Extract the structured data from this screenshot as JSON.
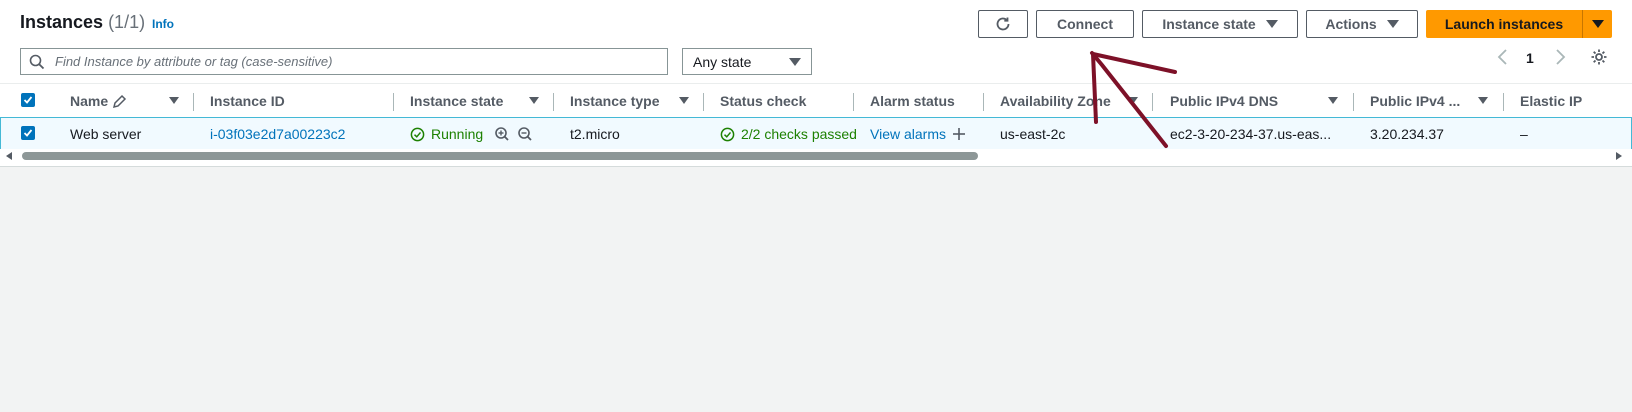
{
  "header": {
    "title": "Instances",
    "count": "(1/1)",
    "info": "Info"
  },
  "toolbar": {
    "refresh_icon": "refresh-icon",
    "connect": "Connect",
    "instance_state": "Instance state",
    "actions": "Actions",
    "launch": "Launch instances"
  },
  "filter": {
    "search_placeholder": "Find Instance by attribute or tag (case-sensitive)",
    "state_select": "Any state"
  },
  "pagination": {
    "current_page": "1"
  },
  "table": {
    "columns": [
      "Name",
      "Instance ID",
      "Instance state",
      "Instance type",
      "Status check",
      "Alarm status",
      "Availability Zone",
      "Public IPv4 DNS",
      "Public IPv4 ...",
      "Elastic IP"
    ],
    "rows": [
      {
        "name": "Web server",
        "instance_id": "i-03f03e2d7a00223c2",
        "state": "Running",
        "type": "t2.micro",
        "status_check": "2/2 checks passed",
        "alarm": "View alarms",
        "az": "us-east-2c",
        "dns": "ec2-3-20-234-37.us-eas...",
        "ipv4": "3.20.234.37",
        "elastic_ip": "–"
      }
    ]
  },
  "colors": {
    "primary": "#ff9900",
    "link": "#0073bb",
    "success": "#1d8102",
    "annotation": "#7d1128"
  }
}
